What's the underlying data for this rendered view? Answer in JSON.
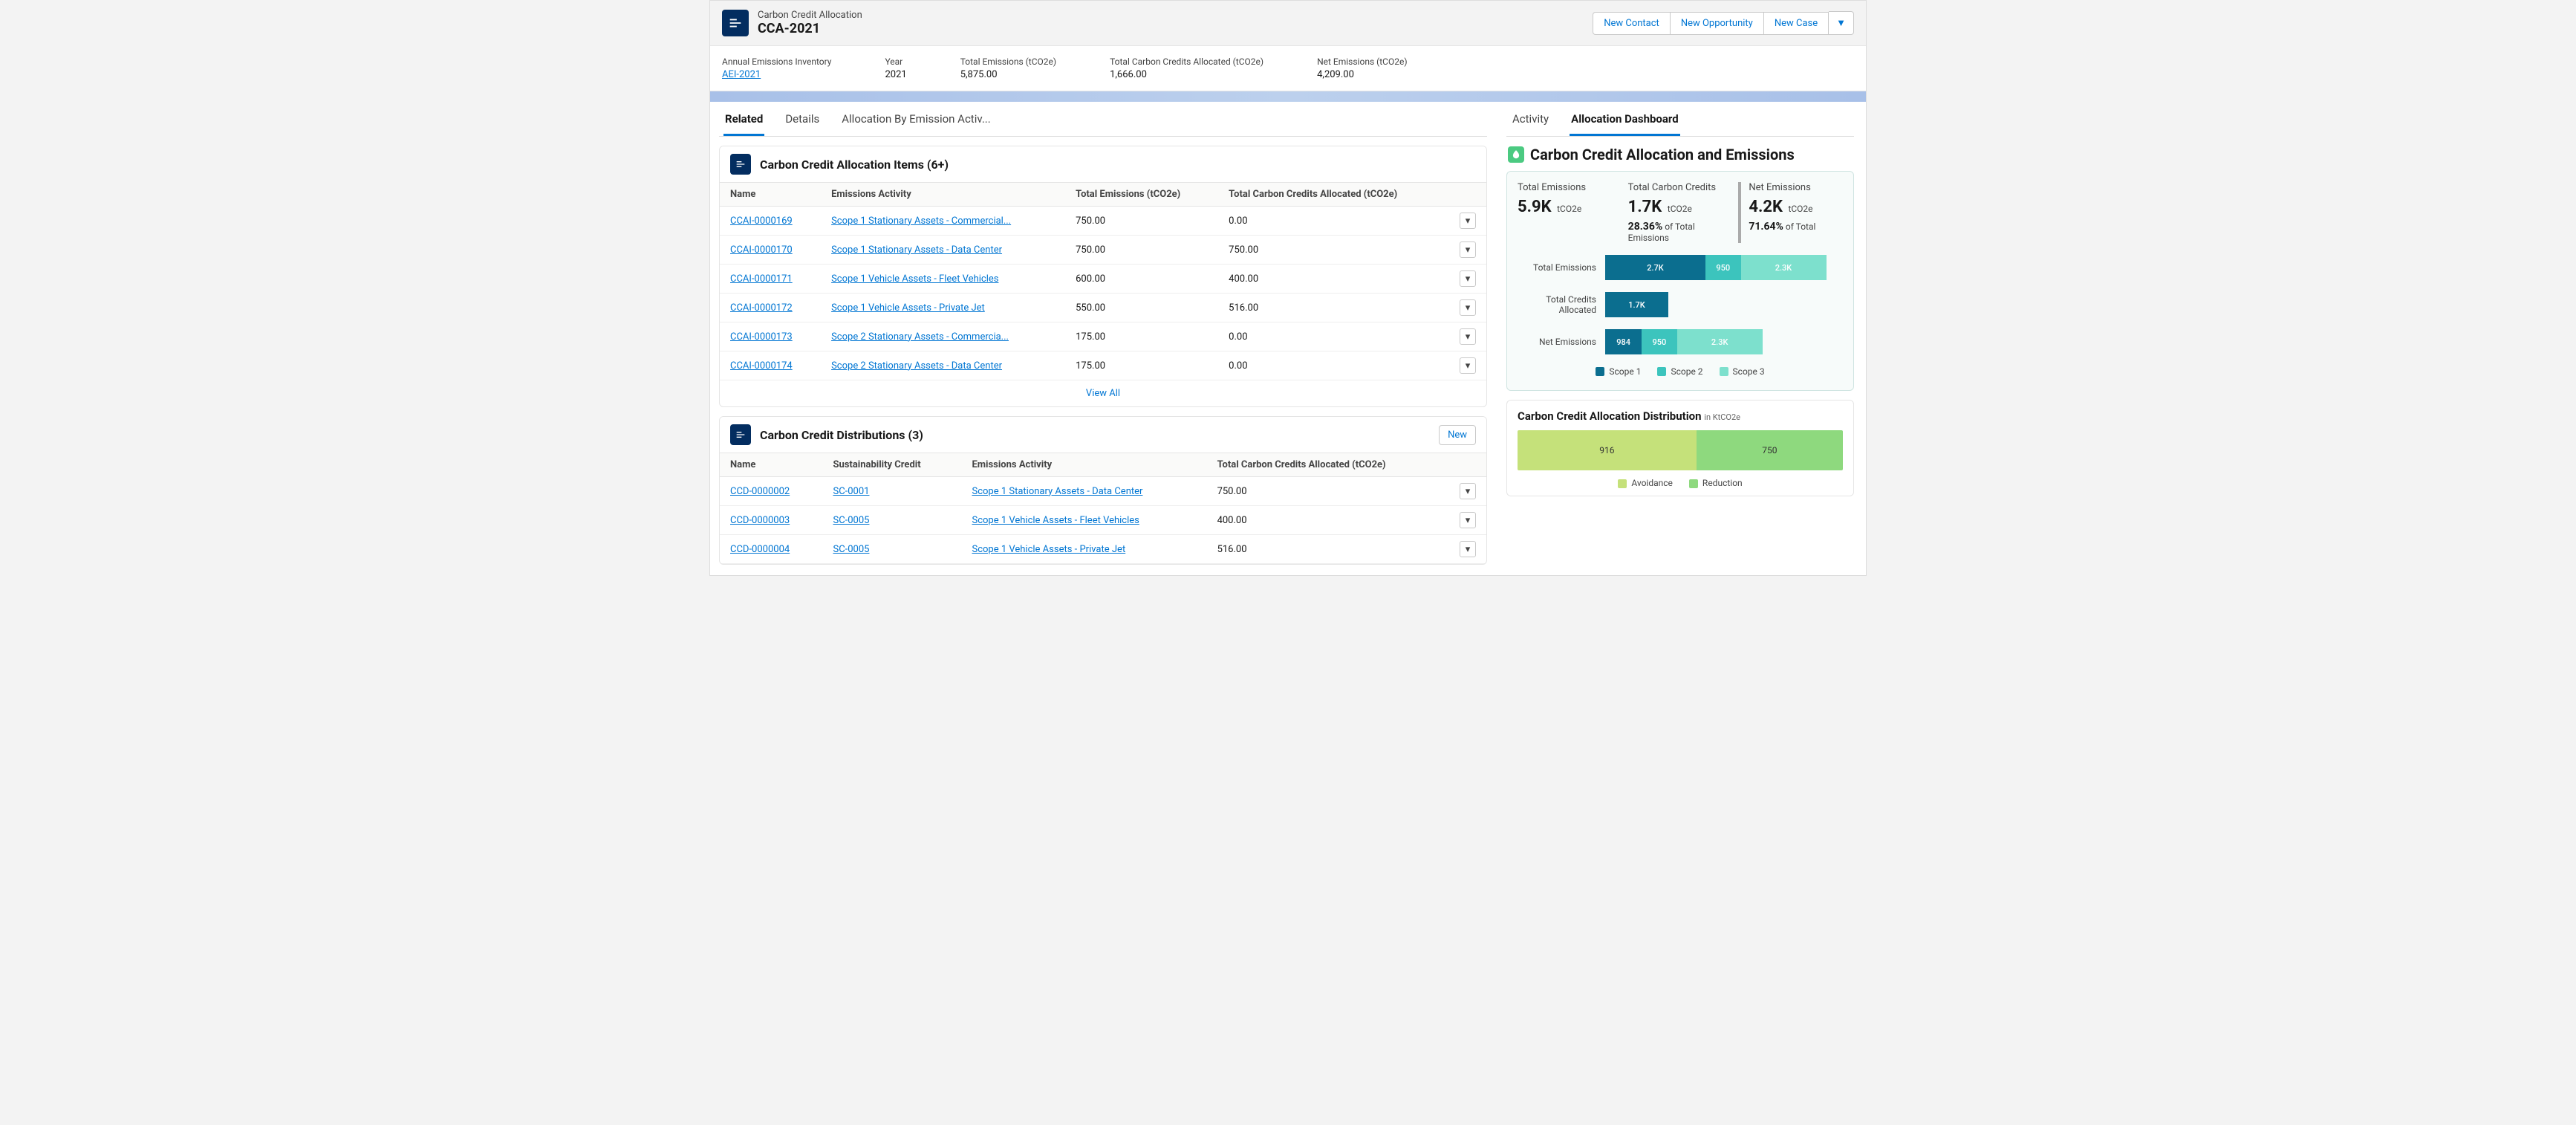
{
  "header": {
    "subtitle": "Carbon Credit Allocation",
    "title": "CCA-2021",
    "actions": {
      "new_contact": "New Contact",
      "new_opportunity": "New Opportunity",
      "new_case": "New Case"
    }
  },
  "summary": [
    {
      "label": "Annual Emissions Inventory",
      "value": "AEI-2021",
      "link": true
    },
    {
      "label": "Year",
      "value": "2021"
    },
    {
      "label": "Total Emissions (tCO2e)",
      "value": "5,875.00"
    },
    {
      "label": "Total Carbon Credits Allocated (tCO2e)",
      "value": "1,666.00"
    },
    {
      "label": "Net Emissions (tCO2e)",
      "value": "4,209.00"
    }
  ],
  "tabs_left": {
    "related": "Related",
    "details": "Details",
    "allocation_by": "Allocation By Emission Activ..."
  },
  "tabs_right": {
    "activity": "Activity",
    "dashboard": "Allocation Dashboard"
  },
  "alloc_items": {
    "title": "Carbon Credit Allocation Items (6+)",
    "cols": {
      "name": "Name",
      "activity": "Emissions Activity",
      "total": "Total Emissions (tCO2e)",
      "credits": "Total Carbon Credits Allocated (tCO2e)"
    },
    "rows": [
      {
        "name": "CCAI-0000169",
        "activity": "Scope 1 Stationary Assets - Commercial...",
        "total": "750.00",
        "credits": "0.00"
      },
      {
        "name": "CCAI-0000170",
        "activity": "Scope 1 Stationary Assets - Data Center",
        "total": "750.00",
        "credits": "750.00"
      },
      {
        "name": "CCAI-0000171",
        "activity": "Scope 1 Vehicle Assets - Fleet Vehicles",
        "total": "600.00",
        "credits": "400.00"
      },
      {
        "name": "CCAI-0000172",
        "activity": "Scope 1 Vehicle Assets - Private Jet",
        "total": "550.00",
        "credits": "516.00"
      },
      {
        "name": "CCAI-0000173",
        "activity": "Scope 2 Stationary Assets - Commercia...",
        "total": "175.00",
        "credits": "0.00"
      },
      {
        "name": "CCAI-0000174",
        "activity": "Scope 2 Stationary Assets - Data Center",
        "total": "175.00",
        "credits": "0.00"
      }
    ],
    "view_all": "View All"
  },
  "distributions": {
    "title": "Carbon Credit Distributions (3)",
    "new_label": "New",
    "cols": {
      "name": "Name",
      "credit": "Sustainability Credit",
      "activity": "Emissions Activity",
      "credits": "Total Carbon Credits Allocated (tCO2e)"
    },
    "rows": [
      {
        "name": "CCD-0000002",
        "credit": "SC-0001",
        "activity": "Scope 1 Stationary Assets - Data Center",
        "credits": "750.00"
      },
      {
        "name": "CCD-0000003",
        "credit": "SC-0005",
        "activity": "Scope 1 Vehicle Assets - Fleet Vehicles",
        "credits": "400.00"
      },
      {
        "name": "CCD-0000004",
        "credit": "SC-0005",
        "activity": "Scope 1 Vehicle Assets - Private Jet",
        "credits": "516.00"
      }
    ]
  },
  "dashboard": {
    "title": "Carbon Credit Allocation and Emissions",
    "kpis": {
      "total_emissions": {
        "label": "Total Emissions",
        "value": "5.9K",
        "unit": "tCO2e"
      },
      "total_credits": {
        "label": "Total Carbon Credits",
        "value": "1.7K",
        "unit": "tCO2e",
        "sub_pct": "28.36%",
        "sub_text": "of Total Emissions"
      },
      "net": {
        "label": "Net Emissions",
        "value": "4.2K",
        "unit": "tCO2e",
        "sub_pct": "71.64%",
        "sub_text": "of Total"
      }
    },
    "legend": {
      "s1": "Scope 1",
      "s2": "Scope 2",
      "s3": "Scope 3"
    },
    "dist": {
      "title": "Carbon Credit Allocation Distribution",
      "unit": "in KtCO2e",
      "avoidance_label": "Avoidance",
      "reduction_label": "Reduction"
    }
  },
  "chart_data": {
    "emissions_stacked": {
      "type": "bar",
      "orientation": "horizontal",
      "stacked": true,
      "categories": [
        "Total Emissions",
        "Total Credits Allocated",
        "Net Emissions"
      ],
      "series": [
        {
          "name": "Scope 1",
          "values": [
            2700,
            1700,
            984
          ],
          "labels": [
            "2.7K",
            "1.7K",
            "984"
          ],
          "color": "#0b6e8f"
        },
        {
          "name": "Scope 2",
          "values": [
            950,
            0,
            950
          ],
          "labels": [
            "950",
            "",
            "950"
          ],
          "color": "#3cc4bd"
        },
        {
          "name": "Scope 3",
          "values": [
            2300,
            0,
            2300
          ],
          "labels": [
            "2.3K",
            "",
            "2.3K"
          ],
          "color": "#7de0cd"
        }
      ],
      "xlim": [
        0,
        6000
      ],
      "unit": "tCO2e"
    },
    "allocation_distribution": {
      "type": "bar",
      "orientation": "horizontal",
      "stacked": true,
      "categories": [
        ""
      ],
      "series": [
        {
          "name": "Avoidance",
          "values": [
            916
          ],
          "color": "#c5e17a"
        },
        {
          "name": "Reduction",
          "values": [
            750
          ],
          "color": "#8ed97e"
        }
      ],
      "unit": "KtCO2e"
    }
  }
}
